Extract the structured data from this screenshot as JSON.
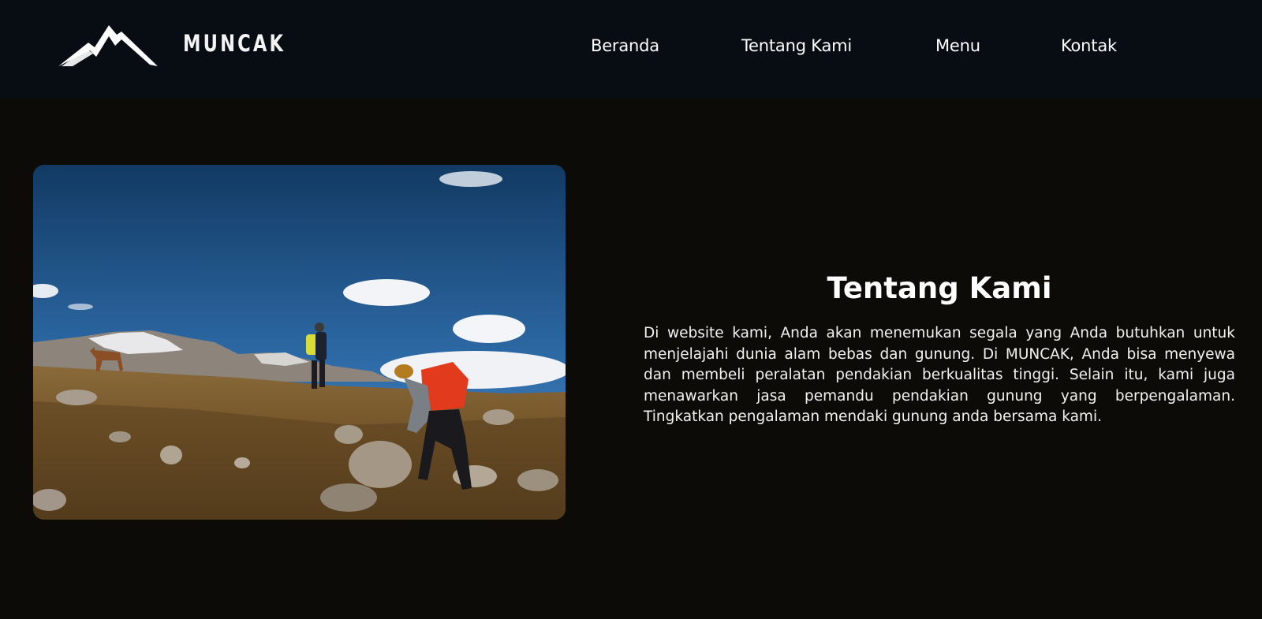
{
  "brand": {
    "name": "MUNCAK",
    "logo_icon": "mountain-logo-icon"
  },
  "nav": {
    "items": [
      {
        "label": "Beranda"
      },
      {
        "label": "Tentang Kami"
      },
      {
        "label": "Menu"
      },
      {
        "label": "Kontak"
      }
    ]
  },
  "about": {
    "title": "Tentang Kami",
    "body": "Di website kami, Anda akan menemukan segala yang Anda butuhkan untuk menjelajahi dunia alam bebas dan gunung. Di MUNCAK, Anda bisa menyewa dan membeli peralatan pendakian berkualitas tinggi. Selain itu, kami juga menawarkan jasa pemandu pendakian gunung yang berpengalaman. Tingkatkan pengalaman mendaki gunung anda bersama kami.",
    "image": "hikers-mountain-photo"
  },
  "colors": {
    "navbar_bg": "#080c13",
    "page_bg": "#0d0b08",
    "text": "#ffffff"
  }
}
